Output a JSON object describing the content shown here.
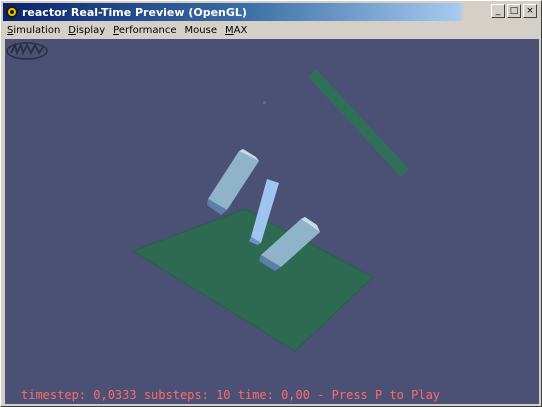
{
  "window": {
    "title": "reactor Real-Time Preview (OpenGL)",
    "buttons": {
      "minimize": "_",
      "maximize": "□",
      "close": "×"
    }
  },
  "menu": {
    "items": [
      {
        "label": "Simulation",
        "underline": "S",
        "rest": "imulation"
      },
      {
        "label": "Display",
        "underline": "D",
        "rest": "isplay"
      },
      {
        "label": "Performance",
        "underline": "P",
        "rest": "erformance"
      },
      {
        "label": "Mouse",
        "underline": "",
        "rest": "Mouse"
      },
      {
        "label": "MAX",
        "underline": "M",
        "rest": "AX"
      }
    ]
  },
  "viewport": {
    "background": "#4b5175",
    "status": "timestep: 0,0333 substeps: 10 time: 0,00 - Press P to Play",
    "logo": "havok-logo"
  },
  "colors": {
    "plane": "#2e6a52",
    "plank": "#2f6e58",
    "box_light": "#8fb3c8",
    "box_dark": "#5b7fa8",
    "box_blue": "#9ec4ef",
    "status": "#ff6a6a"
  }
}
